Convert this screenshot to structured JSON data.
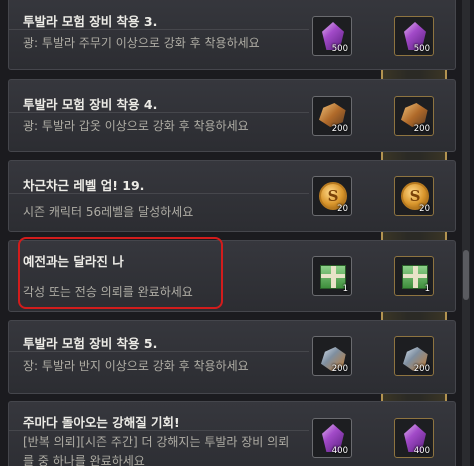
{
  "quests": [
    {
      "title": "투발라 모험 장비 착용 3.",
      "desc": "광: 투발라 주무기 이상으로 강화 후 착용하세요",
      "reward_icon": "amethyst-icon",
      "reward_count": "500",
      "premium_icon": "amethyst-icon",
      "premium_count": "500"
    },
    {
      "title": "투발라 모험 장비 착용 4.",
      "desc": "광: 투발라 갑옷 이상으로 강화 후 착용하세요",
      "reward_icon": "ore-icon",
      "reward_count": "200",
      "premium_icon": "ore-icon",
      "premium_count": "200"
    },
    {
      "title": "차근차근 레벨 업! 19.",
      "desc": "시즌 캐릭터 56레벨을 달성하세요",
      "reward_icon": "coin-icon",
      "reward_count": "20",
      "premium_icon": "coin-icon",
      "premium_count": "20"
    },
    {
      "title": "예전과는 달라진 나",
      "desc": "각성 또는 전승 의뢰를 완료하세요",
      "reward_icon": "gift-box-icon",
      "reward_count": "1",
      "premium_icon": "gift-box-icon",
      "premium_count": "1"
    },
    {
      "title": "투발라 모험 장비 착용 5.",
      "desc": "장: 투발라 반지 이상으로 강화 후 착용하세요",
      "reward_icon": "ring-ore-icon",
      "reward_count": "200",
      "premium_icon": "ring-ore-icon",
      "premium_count": "200"
    },
    {
      "title": "주마다 돌아오는 강해질 기회!",
      "desc": "[반복 의뢰][시즌 주간] 더 강해지는 투발라 장비 의뢰를 중 하나를 완료하세요",
      "reward_icon": "amethyst-icon",
      "reward_count": "400",
      "premium_icon": "amethyst-icon",
      "premium_count": "400"
    }
  ],
  "lock_icon": "lock-icon",
  "colors": {
    "highlight": "#d21c1c",
    "gold_frame": "#b39350"
  }
}
